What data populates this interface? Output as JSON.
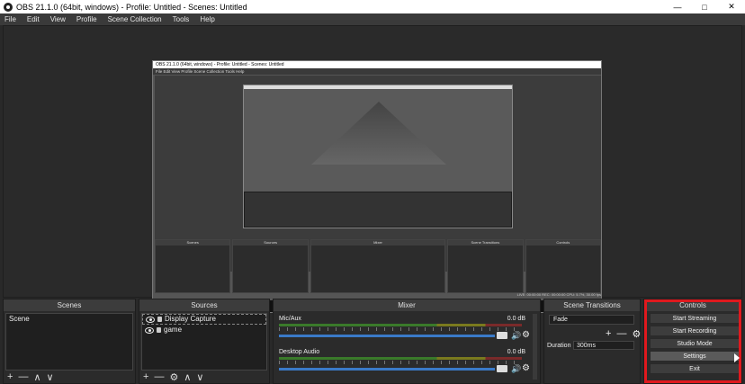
{
  "window": {
    "title": "OBS 21.1.0 (64bit, windows) - Profile: Untitled - Scenes: Untitled",
    "minimize": "—",
    "maximize": "□",
    "close": "✕"
  },
  "menu": [
    "File",
    "Edit",
    "View",
    "Profile",
    "Scene Collection",
    "Tools",
    "Help"
  ],
  "preview": {
    "title": "OBS 21.1.0 (64bit, windows) - Profile: Untitled - Scenes: Untitled",
    "menu": "File   Edit   View   Profile   Scene Collection   Tools   Help",
    "docks": [
      "Scenes",
      "Sources",
      "Mixer",
      "Scene Transitions",
      "Controls"
    ],
    "status": "LIVE: 00:00:00    REC: 00:00:00    CPU: 5.7%, 30.00 fps"
  },
  "scenes": {
    "header": "Scenes",
    "items": [
      "Scene"
    ],
    "toolbar": [
      "+",
      "—",
      "∧",
      "∨"
    ]
  },
  "sources": {
    "header": "Sources",
    "items": [
      "Display Capture",
      "game"
    ],
    "toolbar": [
      "+",
      "—",
      "⚙",
      "∧",
      "∨"
    ]
  },
  "mixer": {
    "header": "Mixer",
    "channels": [
      {
        "name": "Mic/Aux",
        "db": "0.0 dB",
        "volume": 0.89
      },
      {
        "name": "Desktop Audio",
        "db": "0.0 dB",
        "volume": 0.89
      }
    ]
  },
  "transitions": {
    "header": "Scene Transitions",
    "selected": "Fade",
    "duration_label": "Duration",
    "duration_value": "300ms",
    "controls": [
      "+",
      "—",
      "⚙"
    ]
  },
  "controls": {
    "header": "Controls",
    "buttons": [
      "Start Streaming",
      "Start Recording",
      "Studio Mode",
      "Settings",
      "Exit"
    ],
    "highlight_color": "#e0191e"
  },
  "icons": {
    "app": "obs-logo-icon",
    "eye": "eye-icon",
    "lock": "lock-icon",
    "speaker": "speaker-icon",
    "gear": "gear-icon"
  }
}
